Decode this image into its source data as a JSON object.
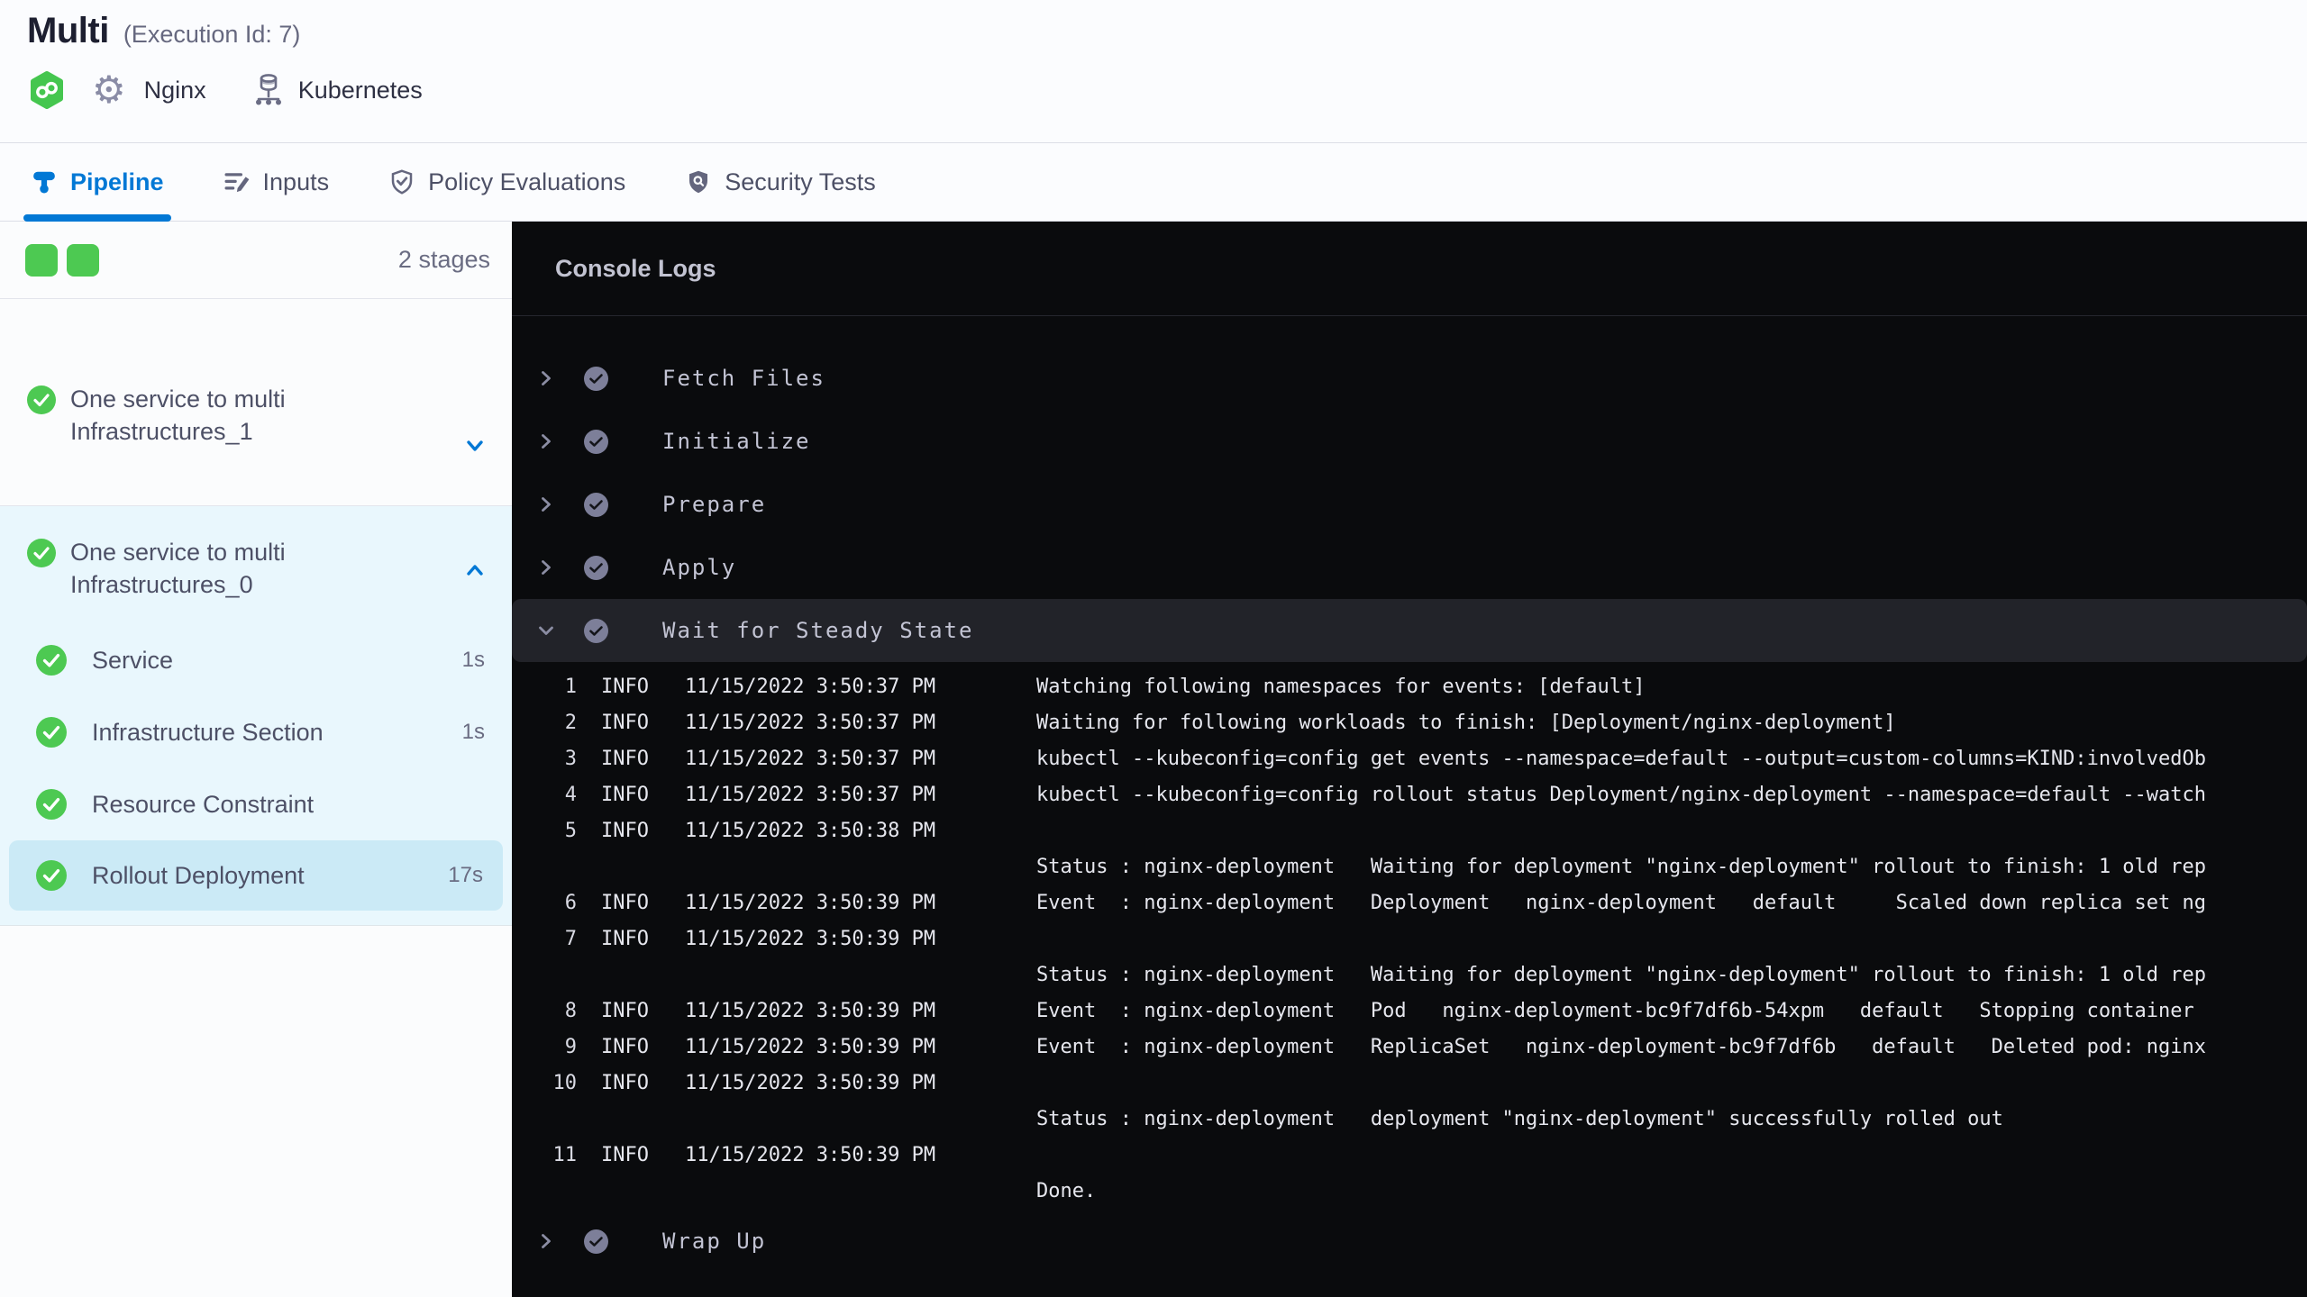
{
  "header": {
    "title": "Multi",
    "execution_id": "(Execution Id: 7)",
    "service_chip": "Nginx",
    "infra_chip": "Kubernetes"
  },
  "tabs": [
    {
      "label": "Pipeline",
      "active": true
    },
    {
      "label": "Inputs",
      "active": false
    },
    {
      "label": "Policy Evaluations",
      "active": false
    },
    {
      "label": "Security Tests",
      "active": false
    }
  ],
  "sidebar": {
    "stages_count": "2 stages",
    "stages": [
      {
        "name": "One service to multi Infrastructures_1",
        "expanded": false,
        "status": "success"
      },
      {
        "name": "One service to multi Infrastructures_0",
        "expanded": true,
        "status": "success",
        "steps": [
          {
            "label": "Service",
            "duration": "1s",
            "selected": false
          },
          {
            "label": "Infrastructure Section",
            "duration": "1s",
            "selected": false
          },
          {
            "label": "Resource Constraint",
            "duration": "",
            "selected": false
          },
          {
            "label": "Rollout Deployment",
            "duration": "17s",
            "selected": true
          }
        ]
      }
    ]
  },
  "console": {
    "title": "Console Logs",
    "steps": [
      {
        "label": "Fetch Files",
        "state": "collapsed"
      },
      {
        "label": "Initialize",
        "state": "collapsed"
      },
      {
        "label": "Prepare",
        "state": "collapsed"
      },
      {
        "label": "Apply",
        "state": "collapsed"
      },
      {
        "label": "Wait for Steady State",
        "state": "expanded"
      },
      {
        "label": "Wrap Up",
        "state": "collapsed"
      }
    ],
    "logs": [
      {
        "num": "1",
        "level": "INFO",
        "time": "11/15/2022 3:50:37 PM",
        "msg": "Watching following namespaces for events: [default]"
      },
      {
        "num": "2",
        "level": "INFO",
        "time": "11/15/2022 3:50:37 PM",
        "msg": "Waiting for following workloads to finish: [Deployment/nginx-deployment]"
      },
      {
        "num": "3",
        "level": "INFO",
        "time": "11/15/2022 3:50:37 PM",
        "msg": "kubectl --kubeconfig=config get events --namespace=default --output=custom-columns=KIND:involvedOb"
      },
      {
        "num": "4",
        "level": "INFO",
        "time": "11/15/2022 3:50:37 PM",
        "msg": "kubectl --kubeconfig=config rollout status Deployment/nginx-deployment --namespace=default --watch"
      },
      {
        "num": "5",
        "level": "INFO",
        "time": "11/15/2022 3:50:38 PM",
        "msg": ""
      },
      {
        "num": "",
        "level": "",
        "time": "",
        "msg": "Status : nginx-deployment   Waiting for deployment \"nginx-deployment\" rollout to finish: 1 old rep"
      },
      {
        "num": "6",
        "level": "INFO",
        "time": "11/15/2022 3:50:39 PM",
        "msg": "Event  : nginx-deployment   Deployment   nginx-deployment   default     Scaled down replica set ng"
      },
      {
        "num": "7",
        "level": "INFO",
        "time": "11/15/2022 3:50:39 PM",
        "msg": ""
      },
      {
        "num": "",
        "level": "",
        "time": "",
        "msg": "Status : nginx-deployment   Waiting for deployment \"nginx-deployment\" rollout to finish: 1 old rep"
      },
      {
        "num": "8",
        "level": "INFO",
        "time": "11/15/2022 3:50:39 PM",
        "msg": "Event  : nginx-deployment   Pod   nginx-deployment-bc9f7df6b-54xpm   default   Stopping container"
      },
      {
        "num": "9",
        "level": "INFO",
        "time": "11/15/2022 3:50:39 PM",
        "msg": "Event  : nginx-deployment   ReplicaSet   nginx-deployment-bc9f7df6b   default   Deleted pod: nginx"
      },
      {
        "num": "10",
        "level": "INFO",
        "time": "11/15/2022 3:50:39 PM",
        "msg": ""
      },
      {
        "num": "",
        "level": "",
        "time": "",
        "msg": "Status : nginx-deployment   deployment \"nginx-deployment\" successfully rolled out"
      },
      {
        "num": "11",
        "level": "INFO",
        "time": "11/15/2022 3:50:39 PM",
        "msg": ""
      },
      {
        "num": "",
        "level": "",
        "time": "",
        "msg": "Done."
      }
    ]
  },
  "colors": {
    "accent_blue": "#0278d5",
    "success_green": "#4dc952",
    "console_bg": "#0a0b0d",
    "console_expanded_row": "#222329",
    "stage_expanded_bg": "#e9f7fd",
    "selected_step_bg": "#cbeaf6"
  }
}
